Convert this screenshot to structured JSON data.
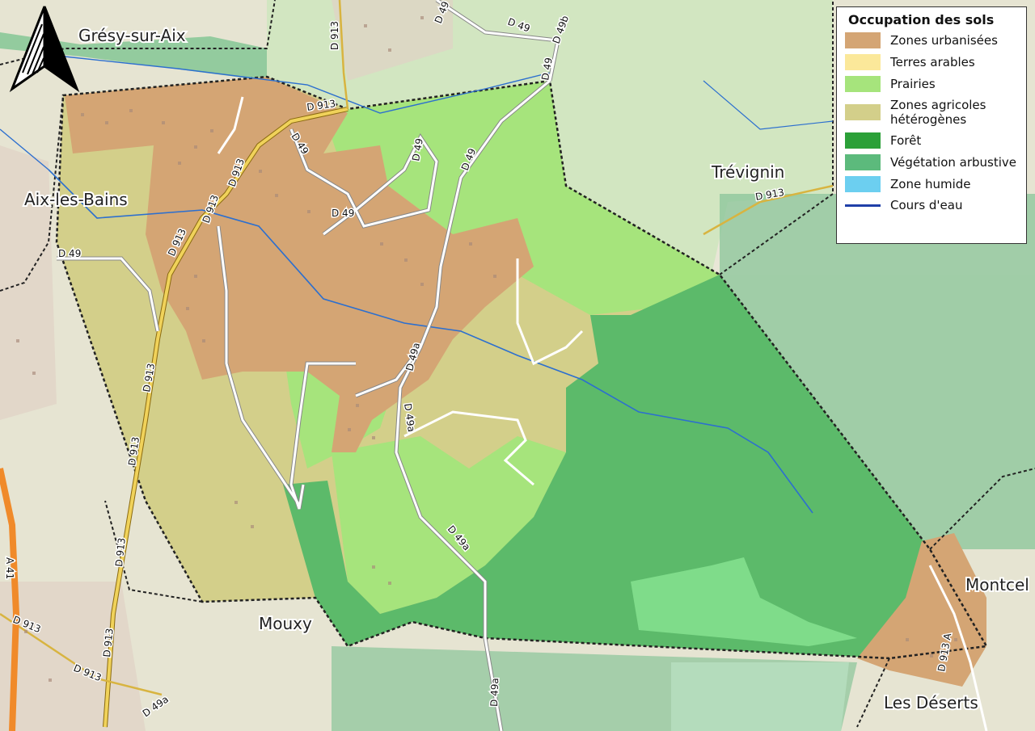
{
  "legend": {
    "title": "Occupation des sols",
    "items": [
      {
        "label": "Zones urbanisées",
        "color": "#d4a574",
        "kind": "area"
      },
      {
        "label": "Terres arables",
        "color": "#fbe89a",
        "kind": "area"
      },
      {
        "label": "Prairies",
        "color": "#a6e47c",
        "kind": "area"
      },
      {
        "label": "Zones agricoles hétérogènes",
        "color": "#d3cf8a",
        "kind": "area"
      },
      {
        "label": "Forêt",
        "color": "#2ba038",
        "kind": "area"
      },
      {
        "label": "Végétation arbustive",
        "color": "#5cba7c",
        "kind": "area"
      },
      {
        "label": "Zone humide",
        "color": "#6ccff0",
        "kind": "area"
      },
      {
        "label": "Cours d'eau",
        "color": "#1f3fa8",
        "kind": "line"
      }
    ]
  },
  "places": {
    "gresy": "Grésy-sur-Aix",
    "aix": "Aix-les-Bains",
    "trevignin": "Trévignin",
    "mouxy": "Mouxy",
    "montcel": "Montcel",
    "deserts": "Les Déserts"
  },
  "roads": {
    "d913": "D 913",
    "d49": "D 49",
    "d49a": "D 49a",
    "d49b": "D 49b",
    "a41": "A 41",
    "d913a": "D 913 A"
  }
}
